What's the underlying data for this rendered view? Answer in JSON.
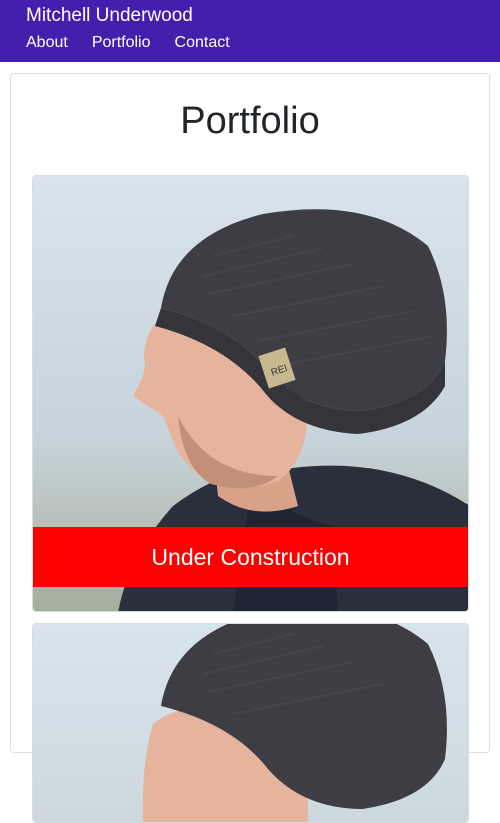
{
  "navbar": {
    "brand": "Mitchell Underwood",
    "links": [
      "About",
      "Portfolio",
      "Contact"
    ]
  },
  "main": {
    "title": "Portfolio",
    "cards": [
      {
        "photo": "portrait-photo",
        "overlay": "Under Construction"
      },
      {
        "photo": "portrait-photo"
      }
    ]
  },
  "colors": {
    "navbar": "#4220ad",
    "overlay": "#ff0000"
  }
}
